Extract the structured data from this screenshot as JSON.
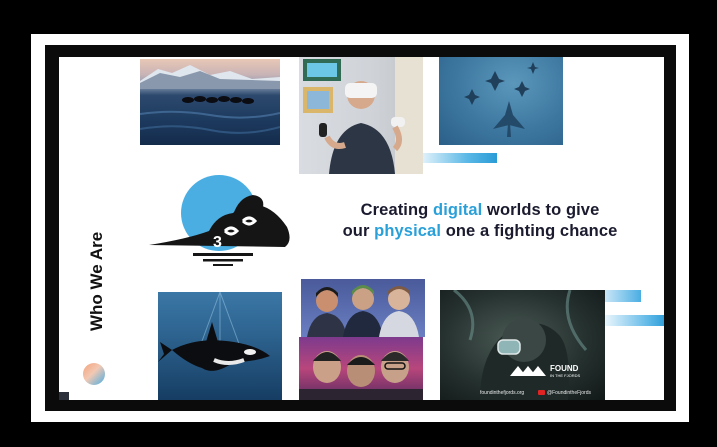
{
  "slide": {
    "section_title": "Who We Are",
    "headline": {
      "line1_pre": "Creating ",
      "line1_highlight": "digital",
      "line1_post": " worlds to give",
      "line2_pre": "our ",
      "line2_highlight": "physical",
      "line2_post": " one a fighting chance"
    },
    "found_badge": {
      "line1": "FOUND",
      "line2": "IN THE FJORDS",
      "website": "foundinthefjords.org",
      "social": "@FoundintheFjords"
    }
  },
  "colors": {
    "accent": "#2aa0d9",
    "headline_text": "#1b1b2f",
    "background": "#000000"
  }
}
